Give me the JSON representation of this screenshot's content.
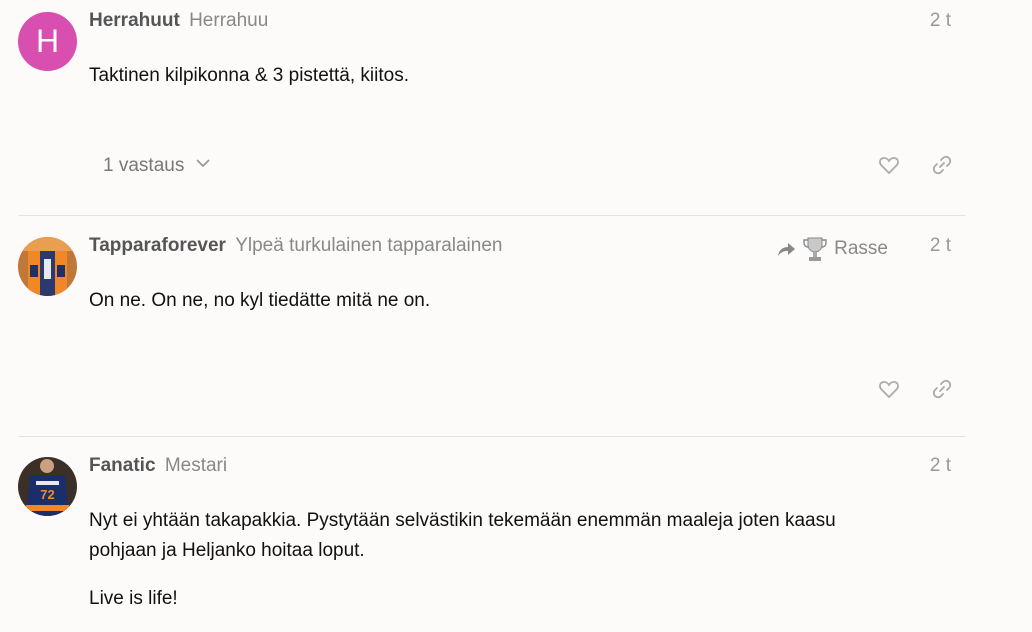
{
  "posts": [
    {
      "avatar_letter": "H",
      "username": "Herrahuut",
      "user_title": "Herrahuu",
      "date": "2 t",
      "paragraphs": [
        "Taktinen kilpikonna & 3 pistettä, kiitos."
      ],
      "replies_label": "1 vastaus"
    },
    {
      "username": "Tapparaforever",
      "user_title": "Ylpeä turkulainen tapparalainen",
      "date": "2 t",
      "reply_to_name": "Rasse",
      "paragraphs": [
        "On ne. On ne, no kyl tiedätte mitä ne on."
      ]
    },
    {
      "username": "Fanatic",
      "user_title": "Mestari",
      "date": "2 t",
      "paragraphs": [
        "Nyt ei yhtään takapakkia. Pystytään selvästikin tekemään enemmän maaleja joten kaasu pohjaan ja Heljanko hoitaa loput.",
        "Live is life!"
      ]
    }
  ],
  "icons": {
    "like": "heart-icon",
    "share": "link-icon",
    "reply_to": "share-arrow-icon",
    "chevron": "chevron-down-icon"
  }
}
